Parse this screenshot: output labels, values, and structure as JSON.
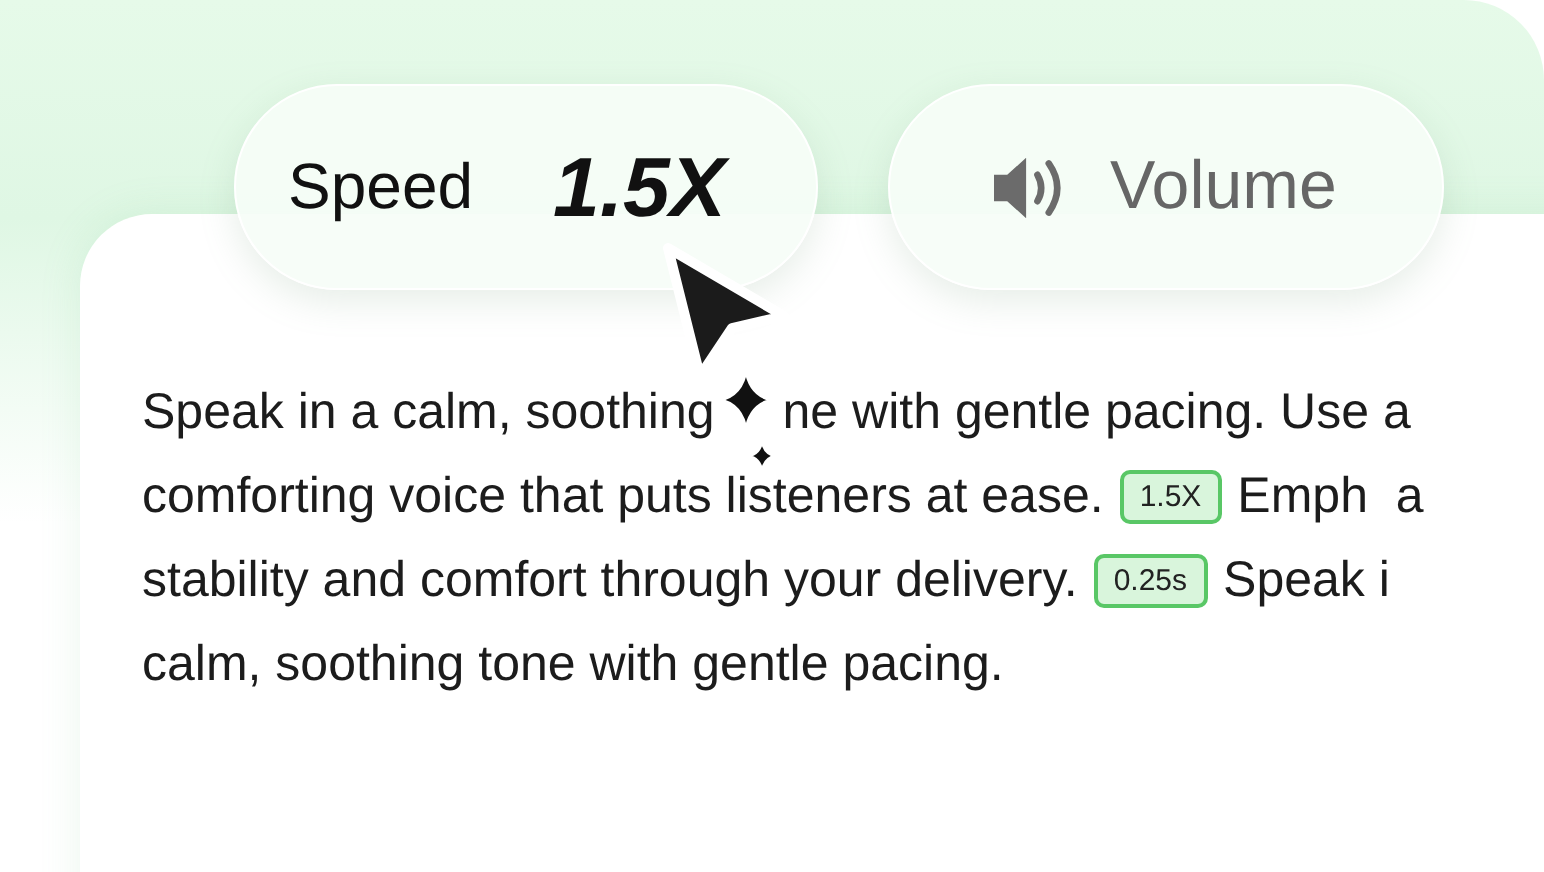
{
  "controls": [
    {
      "kind": "speed",
      "label": "Speed",
      "value": "1.5X"
    },
    {
      "kind": "volume",
      "label": "Volume"
    }
  ],
  "text_lines": [
    [
      {
        "kind": "text",
        "text": "Speak in a calm, soothing"
      },
      {
        "kind": "text",
        "text": "ne with gentle pacing. Use a"
      }
    ],
    [
      {
        "kind": "text",
        "text": "comforting voice that puts listeners at ease."
      },
      {
        "kind": "speed_tag",
        "text": "1.5X"
      },
      {
        "kind": "text",
        "text": "Emph  a"
      }
    ],
    [
      {
        "kind": "text",
        "text": "stability and comfort through your delivery."
      },
      {
        "kind": "pause_tag",
        "text": "0.25s"
      },
      {
        "kind": "text",
        "text": "Speak i"
      }
    ],
    [
      {
        "kind": "text",
        "text": "calm, soothing tone with gentle pacing."
      }
    ]
  ]
}
